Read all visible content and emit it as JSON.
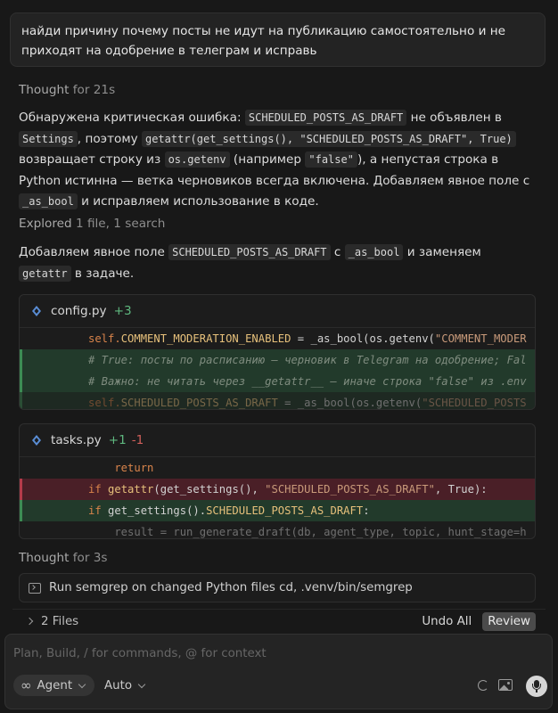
{
  "prompt": {
    "text": "найди причину почему посты не идут на публикацию самостоятельно и не приходят на одобрение в телеграм и исправь"
  },
  "thought1": {
    "label": "Thought",
    "duration": "for 21s"
  },
  "analysis": {
    "t1": "Обнаружена критическая ошибка: ",
    "c1": "SCHEDULED_POSTS_AS_DRAFT",
    "t2": " не объявлен в ",
    "c2": "Settings",
    "t3": ", поэтому ",
    "c3": "getattr(get_settings(), \"SCHEDULED_POSTS_AS_DRAFT\", True)",
    "t4": " возвращает строку из ",
    "c4": "os.getenv",
    "t5": " (например ",
    "c5": "\"false\"",
    "t6": "), а непустая строка в Python истинна — ветка черновиков всегда включена. Добавляем явное поле с ",
    "c6": "_as_bool",
    "t7": " и исправляем использование в коде."
  },
  "explored": {
    "label": "Explored",
    "detail": "1 file, 1 search"
  },
  "fix_note": {
    "t1": "Добавляем явное поле ",
    "c1": "SCHEDULED_POSTS_AS_DRAFT",
    "t2": " с ",
    "c2": "_as_bool",
    "t3": " и заменяем ",
    "c3": "getattr",
    "t4": " в задаче."
  },
  "diff_config": {
    "filename": "config.py",
    "added": "+3",
    "lines": {
      "l1_self": "self.",
      "l1_attr": "COMMENT_MODERATION_ENABLED",
      "l1_rest": " = _as_bool(os.getenv(",
      "l1_str": "\"COMMENT_MODER",
      "l2": "# True: посты по расписанию — черновик в Telegram на одобрение; Fal",
      "l3": "# Важно: не читать через __getattr__ — иначе строка \"false\" из .env",
      "l4_self": "self.",
      "l4_attr": "SCHEDULED_POSTS_AS_DRAFT",
      "l4_rest": " = _as_bool(os.getenv(",
      "l4_str": "\"SCHEDULED_POSTS"
    }
  },
  "diff_tasks": {
    "filename": "tasks.py",
    "added": "+1",
    "removed": "-1",
    "lines": {
      "l1": "    return",
      "l2_kw": "if ",
      "l2_fn": "getattr",
      "l2_a": "(get_settings(), ",
      "l2_str": "\"SCHEDULED_POSTS_AS_DRAFT\"",
      "l2_b": ", True):",
      "l3_kw": "if ",
      "l3_a": "get_settings().",
      "l3_attr": "SCHEDULED_POSTS_AS_DRAFT",
      "l3_b": ":",
      "l4": "    result = run_generate_draft(db, agent_type, topic, hunt_stage=h"
    }
  },
  "thought2": {
    "label": "Thought",
    "duration": "for 3s"
  },
  "terminal": {
    "text": "Run semgrep on changed Python files cd, .venv/bin/semgrep"
  },
  "files_bar": {
    "count": "2 Files",
    "undo": "Undo All",
    "review": "Review"
  },
  "composer": {
    "placeholder": "Plan, Build, / for commands, @ for context",
    "mode": "Agent",
    "model": "Auto",
    "icons": [
      "infinity-icon",
      "chevron-down-icon",
      "spinner-icon",
      "image-icon",
      "microphone-icon"
    ]
  }
}
